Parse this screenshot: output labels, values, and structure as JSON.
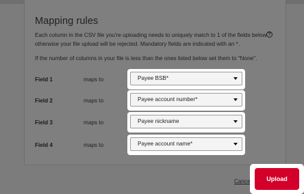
{
  "section": {
    "title": "Mapping rules",
    "description": "Each column in the CSV file you're uploading needs to uniquely match to 1 of the fields below otherwise your file upload will be rejected. Mandatory fields are indicated with an *.",
    "help_icon": "question-circle",
    "note": "If the number of columns in your file is less than the ones listed below set them to \"None\"."
  },
  "mappings": [
    {
      "field": "Field 1",
      "maps_to": "maps to",
      "value": "Payee BSB*"
    },
    {
      "field": "Field 2",
      "maps_to": "maps to",
      "value": "Payee account number*"
    },
    {
      "field": "Field 3",
      "maps_to": "maps to",
      "value": "Payee nickname"
    },
    {
      "field": "Field 4",
      "maps_to": "maps to",
      "value": "Payee account name*"
    }
  ],
  "actions": {
    "cancel_label": "Cancel",
    "upload_label": "Upload"
  },
  "colors": {
    "overlay": "#7c7c7c",
    "upload_button": "#d3002a",
    "highlight_frame": "#ffffff"
  }
}
